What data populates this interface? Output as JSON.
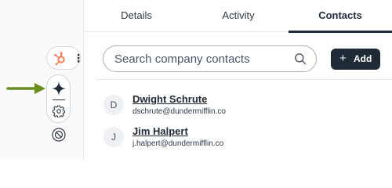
{
  "tabs": [
    {
      "label": "Details"
    },
    {
      "label": "Activity"
    },
    {
      "label": "Contacts",
      "active": true
    }
  ],
  "search": {
    "placeholder": "Search company contacts",
    "value": ""
  },
  "add_button": {
    "label": "Add",
    "icon": "plus-icon"
  },
  "contacts": [
    {
      "initial": "D",
      "name": "Dwight Schrute",
      "email": "dschrute@dundermifflin.co"
    },
    {
      "initial": "J",
      "name": "Jim Halpert",
      "email": "j.halpert@dundermifflin.co"
    }
  ],
  "sidebar": {
    "icons": [
      "hubspot-logo-icon",
      "more-vertical-icon",
      "sparkle-icon",
      "settings-gear-icon",
      "block-icon",
      "pointer-arrow-icon"
    ]
  },
  "colors": {
    "brand_orange": "#ff7a59",
    "dark": "#1f2a36",
    "arrow_green": "#6b8e23",
    "glow_pink": "#e6a0e6"
  }
}
